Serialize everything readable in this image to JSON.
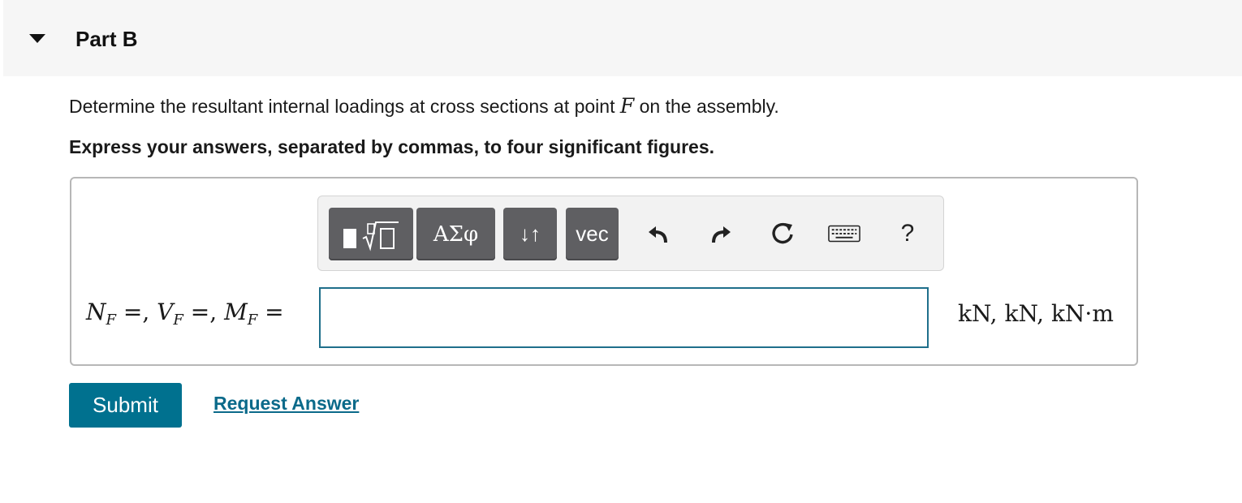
{
  "header": {
    "title": "Part B",
    "caret_icon": "caret-down-icon"
  },
  "question": {
    "prompt_before": "Determine the resultant internal loadings at cross sections at point ",
    "prompt_variable": "F",
    "prompt_after": " on the assembly.",
    "instruction": "Express your answers, separated by commas, to four significant figures."
  },
  "toolbar": {
    "buttons": [
      {
        "name": "templates",
        "label": "▮√▯",
        "icon": "templates-icon"
      },
      {
        "name": "greek",
        "label": "ΑΣφ",
        "icon": "greek-symbols-icon"
      },
      {
        "name": "subscript",
        "label": "↓↑",
        "icon": "arrows-updown-icon"
      },
      {
        "name": "vector",
        "label": "vec",
        "icon": "vector-icon"
      }
    ],
    "undo_icon": "undo-icon",
    "redo_icon": "redo-icon",
    "reset_icon": "reset-icon",
    "keyboard_icon": "keyboard-icon",
    "help_label": "?"
  },
  "answer": {
    "lhs": {
      "n": "N",
      "n_sub": "F",
      "v": "V",
      "v_sub": "F",
      "m": "M",
      "m_sub": "F",
      "eq": " =, ",
      "eq_last": " ="
    },
    "value": "",
    "units": "kN, kN, kN·m"
  },
  "actions": {
    "submit_label": "Submit",
    "request_label": "Request Answer"
  },
  "colors": {
    "accent": "#00718f",
    "link": "#0b6a8a",
    "toolbar_button": "#5f5f62",
    "header_bg": "#f6f6f6"
  }
}
